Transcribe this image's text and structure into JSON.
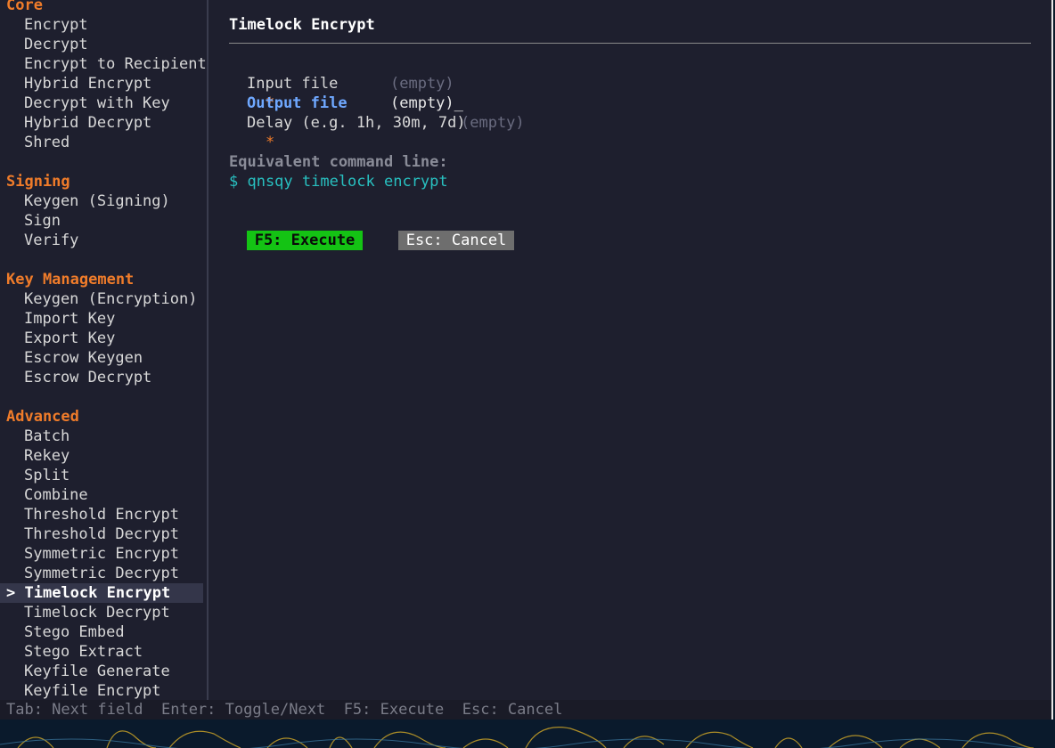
{
  "sidebar": {
    "sections": [
      {
        "header": "Core",
        "items": [
          "Encrypt",
          "Decrypt",
          "Encrypt to Recipient",
          "Hybrid Encrypt",
          "Decrypt with Key",
          "Hybrid Decrypt",
          "Shred"
        ]
      },
      {
        "header": "Signing",
        "items": [
          "Keygen (Signing)",
          "Sign",
          "Verify"
        ]
      },
      {
        "header": "Key Management",
        "items": [
          "Keygen (Encryption)",
          "Import Key",
          "Export Key",
          "Escrow Keygen",
          "Escrow Decrypt"
        ]
      },
      {
        "header": "Advanced",
        "items": [
          "Batch",
          "Rekey",
          "Split",
          "Combine",
          "Threshold Encrypt",
          "Threshold Decrypt",
          "Symmetric Encrypt",
          "Symmetric Decrypt",
          "Timelock Encrypt",
          "Timelock Decrypt",
          "Stego Embed",
          "Stego Extract",
          "Keyfile Generate",
          "Keyfile Encrypt"
        ]
      }
    ],
    "selected_marker": ">",
    "selected_label": "Timelock Encrypt"
  },
  "main": {
    "title": "Timelock Encrypt",
    "fields": [
      {
        "required_marker": "*",
        "label": "Input file",
        "value": "(empty)"
      },
      {
        "required_marker": "",
        "label": "Output file",
        "value": "(empty)_"
      },
      {
        "required_marker": "*",
        "label": "Delay (e.g. 1h, 30m, 7d)",
        "value": "(empty)"
      }
    ],
    "equivalent_label": "Equivalent command line:",
    "command": "$ qnsqy timelock encrypt",
    "execute_button": "F5: Execute",
    "cancel_button": "Esc: Cancel"
  },
  "statusbar": {
    "text": "Tab: Next field  Enter: Toggle/Next  F5: Execute  Esc: Cancel"
  },
  "colors": {
    "header_orange": "#f07c2a",
    "active_blue": "#6fa8ff",
    "command_cyan": "#28c0c0",
    "execute_green": "#14c314",
    "cancel_gray": "#6e6e6e",
    "background": "#1e1f2e"
  }
}
